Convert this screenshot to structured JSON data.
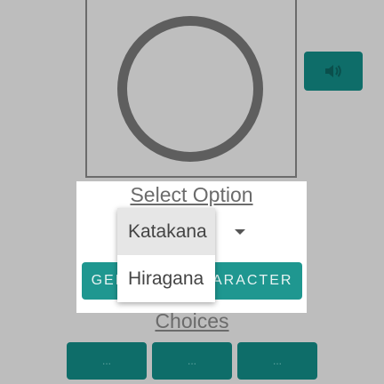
{
  "character_display": {
    "sound_icon": "speaker-icon"
  },
  "select_section": {
    "title": "Select Option",
    "dropdown_caret_icon": "caret-down-icon",
    "options": [
      {
        "label": "Katakana",
        "selected": true
      },
      {
        "label": "Hiragana",
        "selected": false
      }
    ]
  },
  "generate_button": {
    "label": "GENERATE CHARACTER"
  },
  "choices": {
    "title": "Choices",
    "buttons": [
      "...",
      "...",
      "..."
    ]
  },
  "colors": {
    "accent_dark": "#0e6d69",
    "accent": "#1f9790",
    "dim_overlay": "#bdbdbd"
  }
}
